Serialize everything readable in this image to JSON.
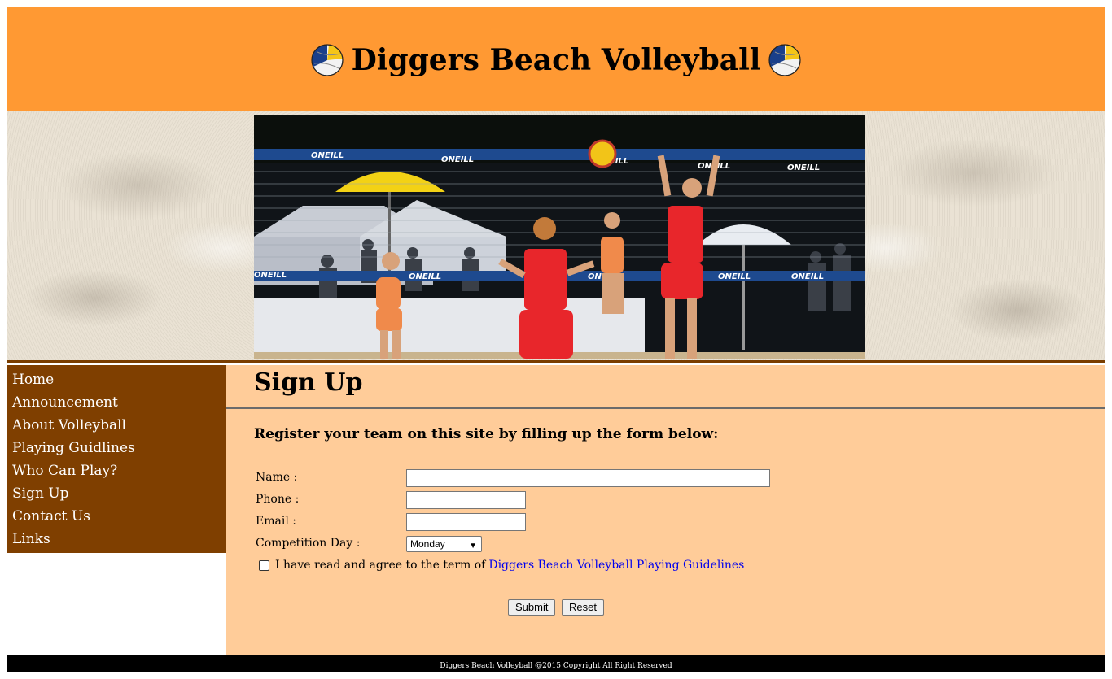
{
  "header": {
    "title": "Diggers Beach Volleyball",
    "left_icon": "volleyball-icon",
    "right_icon": "volleyball-icon"
  },
  "banner": {
    "net_brand": "ONEILL"
  },
  "sidebar": {
    "items": [
      {
        "label": "Home"
      },
      {
        "label": "Announcement"
      },
      {
        "label": "About Volleyball"
      },
      {
        "label": "Playing Guidlines"
      },
      {
        "label": "Who Can Play?"
      },
      {
        "label": "Sign Up"
      },
      {
        "label": "Contact Us"
      },
      {
        "label": "Links"
      }
    ]
  },
  "main": {
    "title": "Sign Up",
    "subtitle": "Register your team on this site by filling up the form below:",
    "form": {
      "name_label": "Name :",
      "name_value": "",
      "phone_label": "Phone :",
      "phone_value": "",
      "email_label": "Email :",
      "email_value": "",
      "day_label": "Competition Day :",
      "day_selected": "Monday",
      "agree_text": "I have read and agree to the term of",
      "agree_link": "Diggers Beach Volleyball Playing Guidelines",
      "submit_label": "Submit",
      "reset_label": "Reset"
    }
  },
  "footer": {
    "text": "Diggers Beach Volleyball @2015 Copyright All Right Reserved"
  },
  "colors": {
    "header_bg": "#ff9933",
    "sidebar_bg": "#7f3f00",
    "main_bg": "#ffcc99",
    "footer_bg": "#000000",
    "link": "#0000ee"
  }
}
